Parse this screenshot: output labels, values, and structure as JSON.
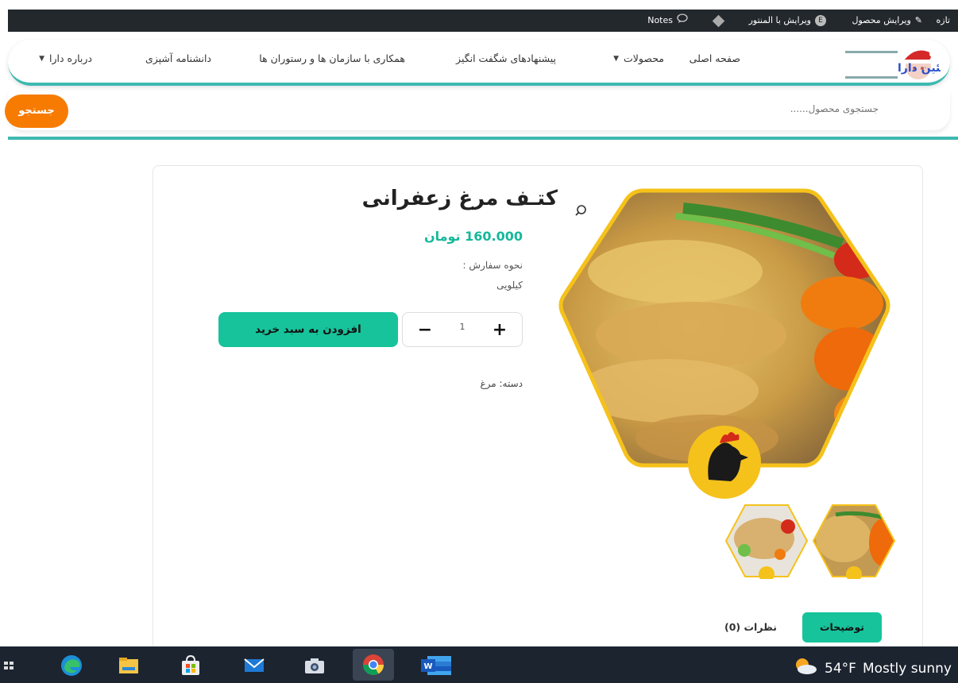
{
  "admin_bar": {
    "new_label": "تازه",
    "edit_product_label": "ویرایش محصول",
    "edit_elementor_label": "ویرایش با المنتور",
    "notes_label": "Notes"
  },
  "nav": {
    "home": "صفحه اصلی",
    "products": "محصولات",
    "offers": "پیشنهادهای شگفت انگیز",
    "cooperation": "همکاری با سازمان ها و رستوران ها",
    "cooking": "دانشنامه آشپزی",
    "about": "درباره دارا"
  },
  "logo": {
    "text": "پروتئین دارا"
  },
  "search": {
    "placeholder": "جستجوی محصول......",
    "button_label": "جستجو"
  },
  "product": {
    "title": "کتـف مرغ زعفرانی",
    "price": "160.000 تومان",
    "order_method_label": "نحوه سفارش :",
    "order_method_value": "کیلویی",
    "quantity": "1",
    "add_to_cart_label": "افزودن به سبد خرید",
    "category_text": "دسته: مرغ"
  },
  "tabs": {
    "description": "توضیحات",
    "reviews": "نظرات (0)"
  },
  "taskbar": {
    "weather_temp": "54°F",
    "weather_text": "Mostly sunny"
  },
  "colors": {
    "accent_teal": "#3fb9b0",
    "button_green": "#17c39b",
    "search_orange": "#f77b00",
    "price_green": "#16b89a",
    "hex_border": "#f5c21b"
  }
}
